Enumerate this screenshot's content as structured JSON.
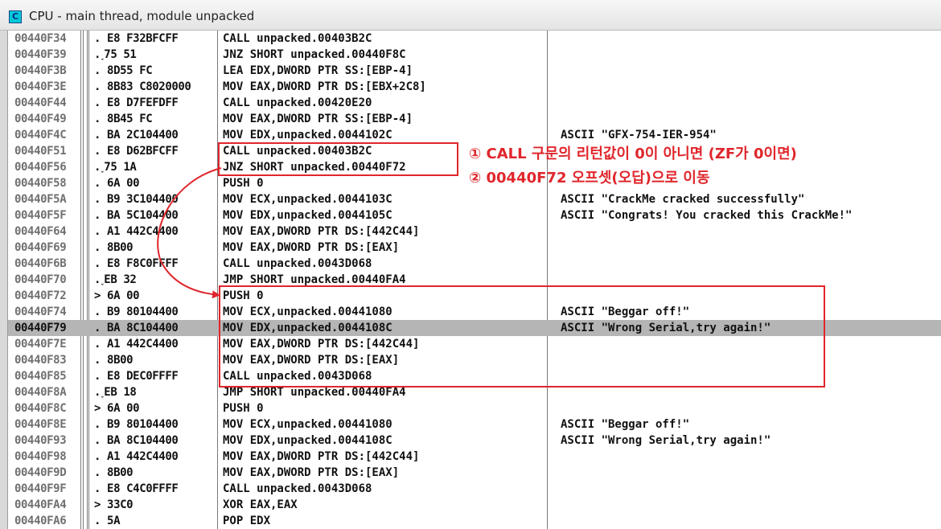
{
  "window": {
    "icon_letter": "C",
    "title": "CPU - main thread, module unpacked"
  },
  "rows": [
    {
      "addr": "00440F34",
      "hex": ". E8 F32BFCFF",
      "asm": "CALL unpacked.00403B2C",
      "comment": ""
    },
    {
      "addr": "00440F39",
      "hex": ".˯75 51",
      "asm": "JNZ SHORT unpacked.00440F8C",
      "comment": ""
    },
    {
      "addr": "00440F3B",
      "hex": ". 8D55 FC",
      "asm": "LEA EDX,DWORD PTR SS:[EBP-4]",
      "comment": ""
    },
    {
      "addr": "00440F3E",
      "hex": ". 8B83 C8020000",
      "asm": "MOV EAX,DWORD PTR DS:[EBX+2C8]",
      "comment": ""
    },
    {
      "addr": "00440F44",
      "hex": ". E8 D7FEFDFF",
      "asm": "CALL unpacked.00420E20",
      "comment": ""
    },
    {
      "addr": "00440F49",
      "hex": ". 8B45 FC",
      "asm": "MOV EAX,DWORD PTR SS:[EBP-4]",
      "comment": ""
    },
    {
      "addr": "00440F4C",
      "hex": ". BA 2C104400",
      "asm": "MOV EDX,unpacked.0044102C",
      "comment": "ASCII \"GFX-754-IER-954\""
    },
    {
      "addr": "00440F51",
      "hex": ". E8 D62BFCFF",
      "asm": "CALL unpacked.00403B2C",
      "comment": ""
    },
    {
      "addr": "00440F56",
      "hex": ".˯75 1A",
      "asm": "JNZ SHORT unpacked.00440F72",
      "comment": ""
    },
    {
      "addr": "00440F58",
      "hex": ". 6A 00",
      "asm": "PUSH 0",
      "comment": ""
    },
    {
      "addr": "00440F5A",
      "hex": ". B9 3C104400",
      "asm": "MOV ECX,unpacked.0044103C",
      "comment": "ASCII \"CrackMe cracked successfully\""
    },
    {
      "addr": "00440F5F",
      "hex": ". BA 5C104400",
      "asm": "MOV EDX,unpacked.0044105C",
      "comment": "ASCII \"Congrats! You cracked this CrackMe!\""
    },
    {
      "addr": "00440F64",
      "hex": ". A1 442C4400",
      "asm": "MOV EAX,DWORD PTR DS:[442C44]",
      "comment": ""
    },
    {
      "addr": "00440F69",
      "hex": ". 8B00",
      "asm": "MOV EAX,DWORD PTR DS:[EAX]",
      "comment": ""
    },
    {
      "addr": "00440F6B",
      "hex": ". E8 F8C0FFFF",
      "asm": "CALL unpacked.0043D068",
      "comment": ""
    },
    {
      "addr": "00440F70",
      "hex": ".˯EB 32",
      "asm": "JMP SHORT unpacked.00440FA4",
      "comment": ""
    },
    {
      "addr": "00440F72",
      "hex": "> 6A 00",
      "asm": "PUSH 0",
      "comment": ""
    },
    {
      "addr": "00440F74",
      "hex": ". B9 80104400",
      "asm": "MOV ECX,unpacked.00441080",
      "comment": "ASCII \"Beggar off!\""
    },
    {
      "addr": "00440F79",
      "hex": ". BA 8C104400",
      "asm": "MOV EDX,unpacked.0044108C",
      "comment": "ASCII \"Wrong Serial,try again!\"",
      "selected": true
    },
    {
      "addr": "00440F7E",
      "hex": ". A1 442C4400",
      "asm": "MOV EAX,DWORD PTR DS:[442C44]",
      "comment": ""
    },
    {
      "addr": "00440F83",
      "hex": ". 8B00",
      "asm": "MOV EAX,DWORD PTR DS:[EAX]",
      "comment": ""
    },
    {
      "addr": "00440F85",
      "hex": ". E8 DEC0FFFF",
      "asm": "CALL unpacked.0043D068",
      "comment": ""
    },
    {
      "addr": "00440F8A",
      "hex": ".˯EB 18",
      "asm": "JMP SHORT unpacked.00440FA4",
      "comment": ""
    },
    {
      "addr": "00440F8C",
      "hex": "> 6A 00",
      "asm": "PUSH 0",
      "comment": ""
    },
    {
      "addr": "00440F8E",
      "hex": ". B9 80104400",
      "asm": "MOV ECX,unpacked.00441080",
      "comment": "ASCII \"Beggar off!\""
    },
    {
      "addr": "00440F93",
      "hex": ". BA 8C104400",
      "asm": "MOV EDX,unpacked.0044108C",
      "comment": "ASCII \"Wrong Serial,try again!\""
    },
    {
      "addr": "00440F98",
      "hex": ". A1 442C4400",
      "asm": "MOV EAX,DWORD PTR DS:[442C44]",
      "comment": ""
    },
    {
      "addr": "00440F9D",
      "hex": ". 8B00",
      "asm": "MOV EAX,DWORD PTR DS:[EAX]",
      "comment": ""
    },
    {
      "addr": "00440F9F",
      "hex": ". E8 C4C0FFFF",
      "asm": "CALL unpacked.0043D068",
      "comment": ""
    },
    {
      "addr": "00440FA4",
      "hex": "> 33C0",
      "asm": "XOR EAX,EAX",
      "comment": ""
    },
    {
      "addr": "00440FA6",
      "hex": ". 5A",
      "asm": "POP EDX",
      "comment": ""
    }
  ],
  "annotations": {
    "line1": "① CALL 구문의 리턴값이 0이 아니면 (ZF가 0이면)",
    "line2": "② 00440F72 오프셋(오답)으로 이동",
    "color": "#e0262c"
  }
}
